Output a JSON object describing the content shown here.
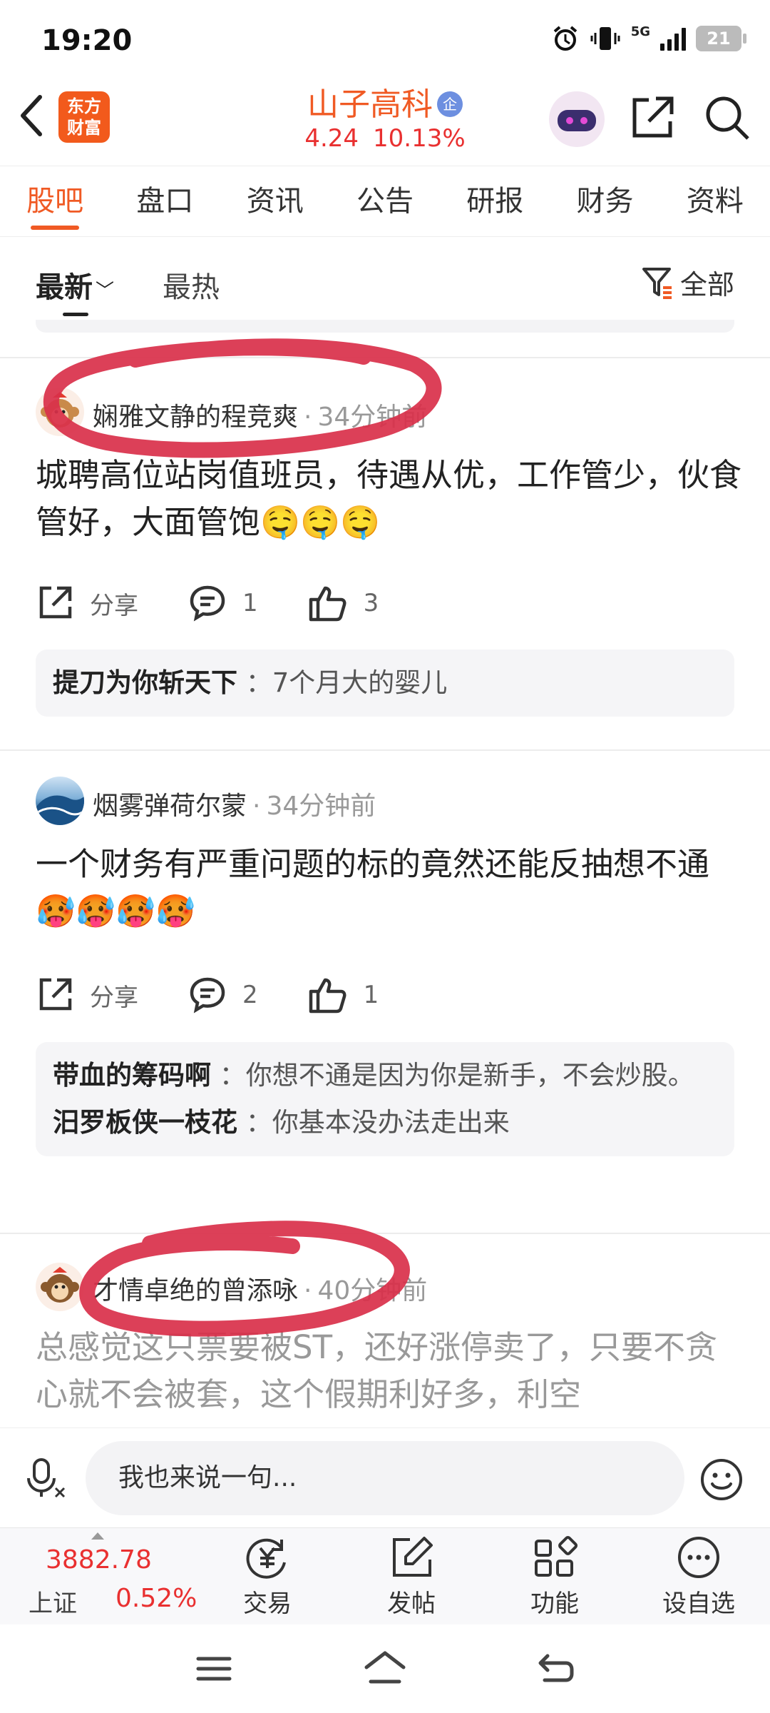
{
  "status_bar": {
    "time": "19:20",
    "network": "5G",
    "battery": "21"
  },
  "header": {
    "back_icon": "chevron-left-icon",
    "app_logo_text": "东方财富",
    "stock_name": "山子高科",
    "stock_badge": "企",
    "price": "4.24",
    "change_pct": "10.13%",
    "share_icon": "share-icon",
    "search_icon": "search-icon"
  },
  "tabs": [
    {
      "label": "股吧",
      "active": true
    },
    {
      "label": "盘口"
    },
    {
      "label": "资讯"
    },
    {
      "label": "公告"
    },
    {
      "label": "研报"
    },
    {
      "label": "财务"
    },
    {
      "label": "资料"
    }
  ],
  "sort": {
    "newest": "最新",
    "hottest": "最热",
    "filter": "全部"
  },
  "posts": [
    {
      "user": "娴雅文静的程竞爽",
      "time": "34分钟前",
      "text": "城聘高位站岗值班员，待遇从优，工作管少，伙食管好，大面管饱🤤🤤🤤",
      "share": "分享",
      "comments": "1",
      "likes": "3",
      "replies": [
        {
          "user": "提刀为你斩天下",
          "text": "7个月大的婴儿"
        }
      ]
    },
    {
      "user": "烟雾弹荷尔蒙",
      "time": "34分钟前",
      "text": "一个财务有严重问题的标的竟然还能反抽想不通🥵🥵🥵🥵",
      "share": "分享",
      "comments": "2",
      "likes": "1",
      "replies": [
        {
          "user": "带血的筹码啊",
          "text": "你想不通是因为你是新手，不会炒股。"
        },
        {
          "user": "汨罗板侠一枝花",
          "text": "你基本没办法走出来"
        }
      ]
    },
    {
      "user": "才情卓绝的曾添咏",
      "time": "40分钟前",
      "text": "总感觉这只票要被ST，还好涨停卖了，只要不贪心就不会被套，这个假期利好多，利空"
    }
  ],
  "input": {
    "placeholder": "我也来说一句..."
  },
  "bottom_bar": {
    "index_value": "3882.78",
    "index_name": "上证",
    "index_change": "0.52%",
    "nav": [
      {
        "label": "交易",
        "icon": "trade-yen-icon"
      },
      {
        "label": "发帖",
        "icon": "post-edit-icon"
      },
      {
        "label": "功能",
        "icon": "apps-grid-icon"
      },
      {
        "label": "设自选",
        "icon": "more-circle-icon"
      }
    ]
  },
  "colors": {
    "accent": "#f05a24",
    "rise": "#e93030",
    "annotation": "#d9304a"
  }
}
